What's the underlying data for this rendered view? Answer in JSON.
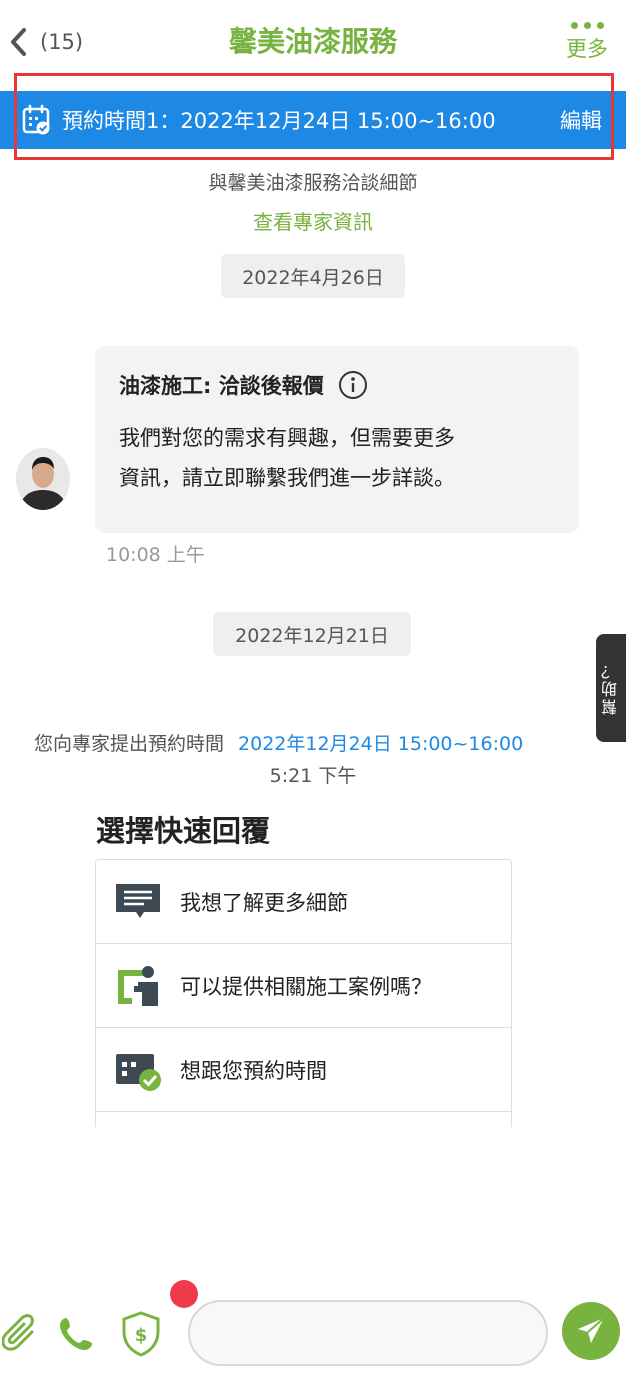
{
  "header": {
    "back_count": "(15)",
    "title": "馨美油漆服務",
    "more_label": "更多"
  },
  "appointment": {
    "text": "預約時間1：2022年12月24日 15:00~16:00",
    "edit_label": "編輯"
  },
  "info": {
    "subtitle": "與馨美油漆服務洽談細節",
    "expert_link": "查看專家資訊"
  },
  "dates": [
    "2022年4月26日",
    "2022年12月21日"
  ],
  "message": {
    "title": "油漆施工: 洽談後報價",
    "body_line1": "我們對您的需求有興趣，但需要更多",
    "body_line2": "資訊，請立即聯繫我們進一步詳談。",
    "time": "10:08 上午"
  },
  "proposal": {
    "text": "您向專家提出預約時間",
    "time_value": "2022年12月24日 15:00~16:00",
    "clock": "5:21 下午"
  },
  "help_tab": "幫助？",
  "quick_replies": {
    "heading": "選擇快速回覆",
    "items": [
      {
        "label": "我想了解更多細節",
        "icon": "chat-lines-icon"
      },
      {
        "label": "可以提供相關施工案例嗎？",
        "icon": "presenter-icon"
      },
      {
        "label": "想跟您預約時間",
        "icon": "calendar-check-icon"
      }
    ]
  },
  "input": {
    "placeholder": ""
  },
  "colors": {
    "brand_green": "#78b33f",
    "appointment_blue": "#1e88e5",
    "highlight_red": "#e53935",
    "record_red": "#ef3a4a"
  }
}
